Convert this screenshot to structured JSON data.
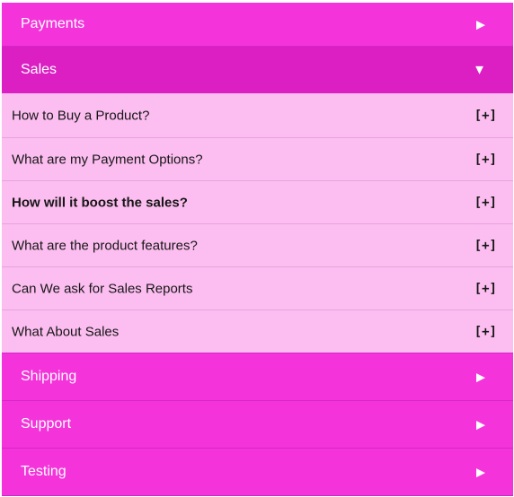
{
  "accordion": {
    "colors": {
      "header": "#f434da",
      "header_open": "#db1fc3",
      "body": "#fcbef0",
      "text_light": "#ffffff",
      "text_dark": "#161616"
    },
    "sections": [
      {
        "title": "Payments",
        "arrow": "▶",
        "state": "collapsed"
      },
      {
        "title": "Sales",
        "arrow": "▼",
        "state": "expanded"
      },
      {
        "title": "Shipping",
        "arrow": "▶",
        "state": "collapsed"
      },
      {
        "title": "Support",
        "arrow": "▶",
        "state": "collapsed"
      },
      {
        "title": "Testing",
        "arrow": "▶",
        "state": "collapsed"
      }
    ],
    "sales_items": [
      {
        "question": "How to Buy a Product?",
        "toggle": "[+]"
      },
      {
        "question": "What are my Payment Options?",
        "toggle": "[+]"
      },
      {
        "question": "How will it boost the sales?",
        "toggle": "[+]"
      },
      {
        "question": "What are the product features?",
        "toggle": "[+]"
      },
      {
        "question": "Can We ask for Sales Reports",
        "toggle": "[+]"
      },
      {
        "question": "What About Sales",
        "toggle": "[+]"
      }
    ]
  }
}
